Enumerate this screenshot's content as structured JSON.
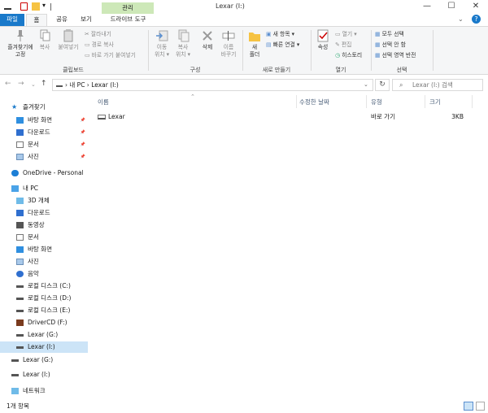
{
  "window": {
    "title": "Lexar (I:)",
    "context_tab": "관리",
    "minimize": "—",
    "maximize": "☐",
    "close": "✕"
  },
  "tabs": [
    {
      "label": "파일"
    },
    {
      "label": "홈"
    },
    {
      "label": "공유"
    },
    {
      "label": "보기"
    },
    {
      "label": "드라이브 도구"
    }
  ],
  "ribbon": {
    "clipboard": {
      "pin_label_1": "즐겨찾기에",
      "pin_label_2": "고정",
      "copy": "복사",
      "paste": "붙여넣기",
      "cut": "잘라내기",
      "copy_path": "경로 복사",
      "paste_shortcut": "바로 가기 붙여넣기",
      "group": "클립보드"
    },
    "organize": {
      "move_1": "이동",
      "move_2": "위치 ▾",
      "copyto_1": "복사",
      "copyto_2": "위치 ▾",
      "delete": "삭제",
      "rename_1": "이름",
      "rename_2": "바꾸기",
      "group": "구성"
    },
    "new": {
      "new_folder_1": "새",
      "new_folder_2": "폴더",
      "new_item": "새 항목 ▾",
      "easy_access": "빠른 연결 ▾",
      "group": "새로 만들기"
    },
    "open": {
      "properties": "속성",
      "open": "열기 ▾",
      "edit": "편집",
      "history": "히스토리",
      "group": "열기"
    },
    "select": {
      "select_all": "모두 선택",
      "select_none": "선택 안 함",
      "invert": "선택 영역 반전",
      "group": "선택"
    }
  },
  "address": {
    "path": "› 내 PC › Lexar (I:)",
    "search_placeholder": "Lexar (I:) 검색"
  },
  "nav": [
    {
      "label": "즐겨찾기",
      "icon": "star-icon",
      "level": 0,
      "pinned": false
    },
    {
      "label": "바탕 화면",
      "icon": "desktop-icon",
      "level": 1,
      "pinned": true
    },
    {
      "label": "다운로드",
      "icon": "download-icon",
      "level": 1,
      "pinned": true
    },
    {
      "label": "문서",
      "icon": "document-icon",
      "level": 1,
      "pinned": true
    },
    {
      "label": "사진",
      "icon": "pictures-icon",
      "level": 1,
      "pinned": true
    },
    {
      "label": "OneDrive - Personal",
      "icon": "cloud-icon",
      "level": 0,
      "pinned": false
    },
    {
      "label": "내 PC",
      "icon": "pc-icon",
      "level": 0,
      "pinned": false
    },
    {
      "label": "3D 개체",
      "icon": "cube-icon",
      "level": 1,
      "pinned": false
    },
    {
      "label": "다운로드",
      "icon": "download-icon",
      "level": 1,
      "pinned": false
    },
    {
      "label": "동영상",
      "icon": "video-icon",
      "level": 1,
      "pinned": false
    },
    {
      "label": "문서",
      "icon": "document-icon",
      "level": 1,
      "pinned": false
    },
    {
      "label": "바탕 화면",
      "icon": "desktop-icon",
      "level": 1,
      "pinned": false
    },
    {
      "label": "사진",
      "icon": "pictures-icon",
      "level": 1,
      "pinned": false
    },
    {
      "label": "음악",
      "icon": "music-icon",
      "level": 1,
      "pinned": false
    },
    {
      "label": "로컬 디스크 (C:)",
      "icon": "drive-icon",
      "level": 1,
      "pinned": false
    },
    {
      "label": "로컬 디스크 (D:)",
      "icon": "drive-icon",
      "level": 1,
      "pinned": false
    },
    {
      "label": "로컬 디스크 (E:)",
      "icon": "drive-icon",
      "level": 1,
      "pinned": false
    },
    {
      "label": "DriverCD (F:)",
      "icon": "cd-icon",
      "level": 1,
      "pinned": false
    },
    {
      "label": "Lexar (G:)",
      "icon": "drive-icon",
      "level": 1,
      "pinned": false
    },
    {
      "label": "Lexar (I:)",
      "icon": "drive-icon",
      "level": 1,
      "pinned": false,
      "selected": true
    },
    {
      "label": "Lexar (G:)",
      "icon": "drive-icon",
      "level": 0,
      "pinned": false
    },
    {
      "label": "Lexar (I:)",
      "icon": "drive-icon",
      "level": 0,
      "pinned": false
    },
    {
      "label": "네트워크",
      "icon": "network-icon",
      "level": 0,
      "pinned": false
    }
  ],
  "columns": {
    "name": "이름",
    "modified": "수정한 날짜",
    "type": "유형",
    "size": "크기"
  },
  "files": [
    {
      "name": "Lexar",
      "modified": "",
      "type": "바로 가기",
      "size": "3KB"
    }
  ],
  "status": {
    "count": "1개 항목"
  },
  "colors": {
    "file_tab": "#1979ca",
    "context_tab": "#cde8b8",
    "selection": "#cce4f7"
  }
}
